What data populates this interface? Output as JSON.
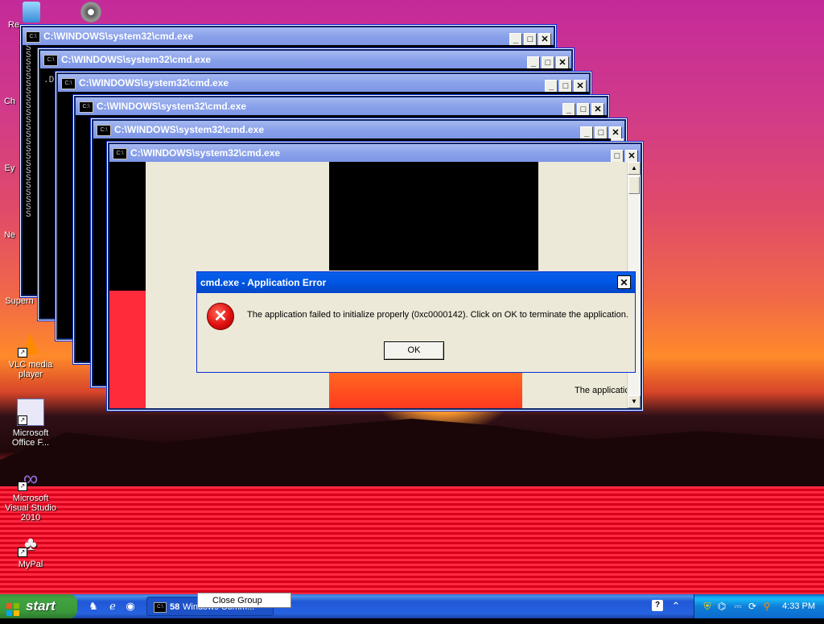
{
  "desktop_icons": [
    {
      "name": "recycle-bin",
      "label": "Re"
    },
    {
      "name": "media",
      "label": ""
    },
    {
      "name": "ch",
      "label": "Ch"
    },
    {
      "name": "ey",
      "label": "Ey"
    },
    {
      "name": "ne",
      "label": "Ne"
    },
    {
      "name": "super",
      "label": "Supern"
    },
    {
      "name": "vlc",
      "label": "VLC media player"
    },
    {
      "name": "office",
      "label": "Microsoft Office F..."
    },
    {
      "name": "visual-studio",
      "label": "Microsoft Visual Studio 2010"
    },
    {
      "name": "mypal",
      "label": "MyPal"
    }
  ],
  "cmd_windows": [
    {
      "title": "C:\\WINDOWS\\system32\\cmd.exe"
    },
    {
      "title": "C:\\WINDOWS\\system32\\cmd.exe"
    },
    {
      "title": "C:\\WINDOWS\\system32\\cmd.exe"
    },
    {
      "title": "C:\\WINDOWS\\system32\\cmd.exe"
    },
    {
      "title": "C:\\WINDOWS\\system32\\cmd.exe"
    },
    {
      "title": "C:\\WINDOWS\\system32\\cmd.exe"
    }
  ],
  "console_lines": [
    "S",
    "S",
    "S",
    "S",
    "S",
    "S",
    "S",
    "S",
    "S",
    "S",
    "S",
    "S",
    "S",
    "S",
    "S",
    "S",
    "S",
    "S",
    "S",
    "S",
    "S",
    "S",
    "S",
    "S"
  ],
  "console_fragment": ".Do",
  "background_text": "The applicatic",
  "dialog": {
    "title": "cmd.exe - Application Error",
    "message": "The application failed to initialize properly (0xc0000142). Click on OK to terminate the application.",
    "ok_label": "OK",
    "close_glyph": "✕"
  },
  "window_buttons": {
    "minimize": "_",
    "maximize": "□",
    "close": "✕"
  },
  "taskbar": {
    "start_label": "start",
    "task_count": "58",
    "task_label": "Windows Comm...",
    "context_menu_item": "Close Group",
    "clock": "4:33 PM",
    "help_glyph": "?"
  },
  "colors": {
    "title_inactive": "#8aa2ea",
    "title_active": "#0058e6",
    "taskbar": "#2157d7",
    "start_green": "#3a9a3a",
    "dialog_bg": "#ece9d8"
  }
}
